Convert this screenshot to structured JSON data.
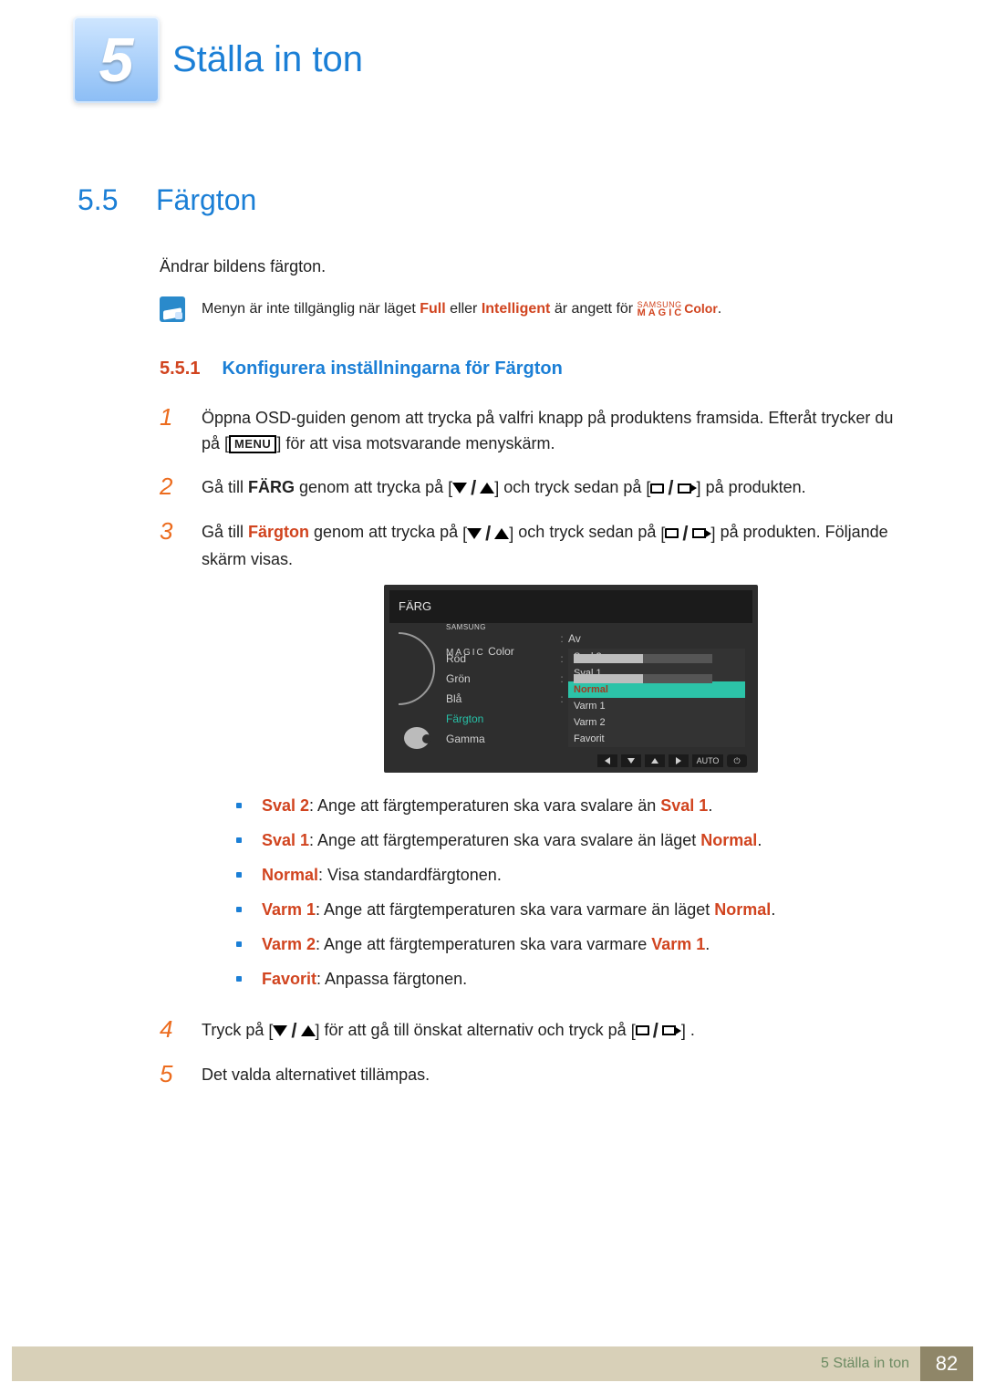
{
  "chapter": {
    "number": "5",
    "title": "Ställa in ton"
  },
  "section": {
    "number": "5.5",
    "title": "Färgton",
    "intro": "Ändrar bildens färgton."
  },
  "note": {
    "pre": "Menyn är inte tillgänglig när läget ",
    "full": "Full",
    "mid": " eller ",
    "intelligent": "Intelligent",
    "post": " är angett för ",
    "brand_top": "SAMSUNG",
    "brand_bot": "MAGIC",
    "brand_word": "Color",
    "end": "."
  },
  "subsection": {
    "number": "5.5.1",
    "title": "Konfigurera inställningarna för Färgton"
  },
  "steps": {
    "s1a": "Öppna OSD-guiden genom att trycka på valfri knapp på produktens framsida. Efteråt trycker du på ",
    "menu": "MENU",
    "s1b": " för att visa motsvarande menyskärm.",
    "s2a": "Gå till ",
    "s2b": "FÄRG",
    "s2c": " genom att trycka på ",
    "s2d": " och tryck sedan på ",
    "s2e": " på produkten.",
    "s3a": "Gå till ",
    "s3b": "Färgton",
    "s3c": " genom att trycka på ",
    "s3d": " och tryck sedan på ",
    "s3e": " på produkten. Följande skärm visas.",
    "s4a": "Tryck på ",
    "s4b": " för att gå till önskat alternativ och tryck på ",
    "s4c": ".",
    "s5": "Det valda alternativet tillämpas.",
    "nums": [
      "1",
      "2",
      "3",
      "4",
      "5"
    ]
  },
  "osd": {
    "header": "FÄRG",
    "brand_top": "SAMSUNG",
    "brand_mid": "MAGIC",
    "brand_word": "Color",
    "av": "Av",
    "rows": {
      "rod": "Röd",
      "gron": "Grön",
      "bla": "Blå",
      "fargton": "Färgton",
      "gamma": "Gamma"
    },
    "val50": "50",
    "options": [
      "Sval 2",
      "Sval 1",
      "Normal",
      "Varm 1",
      "Varm 2",
      "Favorit"
    ],
    "auto": "AUTO"
  },
  "bullets": [
    {
      "k": "Sval 2",
      "t": ": Ange att färgtemperaturen ska vara svalare än ",
      "e": "Sval 1",
      "tail": "."
    },
    {
      "k": "Sval 1",
      "t": ": Ange att färgtemperaturen ska vara svalare än läget ",
      "e": "Normal",
      "tail": "."
    },
    {
      "k": "Normal",
      "t": ": Visa standardfärgtonen.",
      "e": "",
      "tail": ""
    },
    {
      "k": "Varm 1",
      "t": ": Ange att färgtemperaturen ska vara varmare än läget ",
      "e": "Normal",
      "tail": "."
    },
    {
      "k": "Varm 2",
      "t": ": Ange att färgtemperaturen ska vara varmare ",
      "e": "Varm 1",
      "tail": "."
    },
    {
      "k": "Favorit",
      "t": ": Anpassa färgtonen.",
      "e": "",
      "tail": ""
    }
  ],
  "footer": {
    "label": "5 Ställa in ton",
    "page": "82"
  }
}
